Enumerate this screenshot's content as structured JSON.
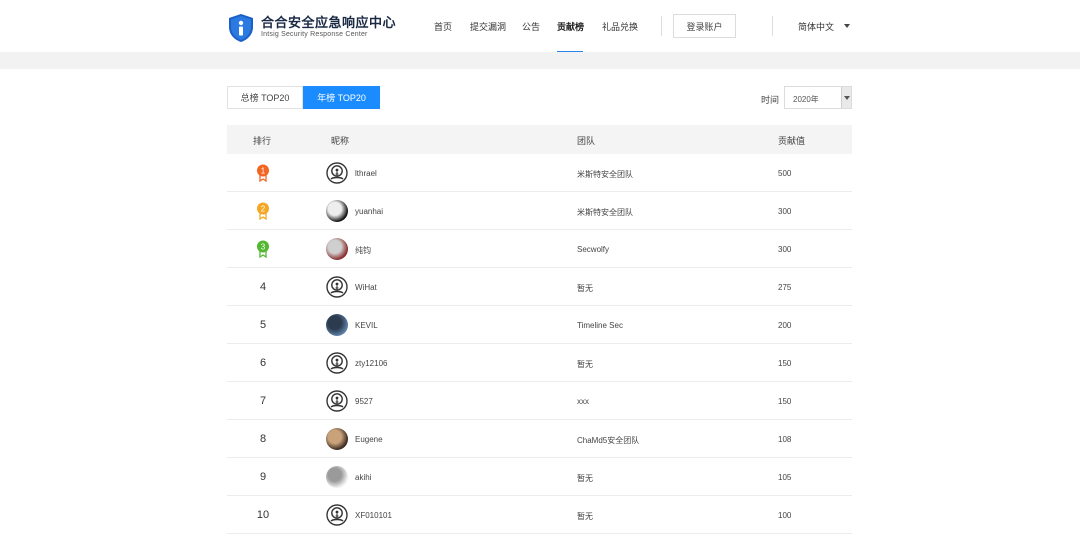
{
  "brand": {
    "title": "合合安全应急响应中心",
    "subtitle": "Intsig Security Response Center"
  },
  "nav": {
    "items": [
      {
        "label": "首页"
      },
      {
        "label": "提交漏洞"
      },
      {
        "label": "公告"
      },
      {
        "label": "贡献榜",
        "active": true
      },
      {
        "label": "礼品兑换"
      }
    ],
    "login": "登录账户",
    "language": "简体中文"
  },
  "tabs": [
    {
      "label": "总榜 TOP20",
      "active": false
    },
    {
      "label": "年榜 TOP20",
      "active": true
    }
  ],
  "filter": {
    "label": "时间",
    "value": "2020年"
  },
  "table": {
    "headers": {
      "rank": "排行",
      "nickname": "昵称",
      "team": "团队",
      "score": "贡献值"
    },
    "rows": [
      {
        "rank": "1",
        "medal": "medal-gold-icon",
        "avatar": "default-avatar-icon",
        "nickname": "lthrael",
        "team": "米斯特安全团队",
        "score": "500"
      },
      {
        "rank": "2",
        "medal": "medal-orange-icon",
        "avatar": "user-photo-avatar",
        "nickname": "yuanhai",
        "team": "米斯特安全团队",
        "score": "300"
      },
      {
        "rank": "3",
        "medal": "medal-green-icon",
        "avatar": "user-photo-avatar",
        "nickname": "纯钧",
        "team": "Secwolfy",
        "score": "300"
      },
      {
        "rank": "4",
        "avatar": "default-avatar-icon",
        "nickname": "WiHat",
        "team": "暂无",
        "score": "275"
      },
      {
        "rank": "5",
        "avatar": "user-photo-avatar",
        "nickname": "KEVIL",
        "team": "Timeline Sec",
        "score": "200"
      },
      {
        "rank": "6",
        "avatar": "default-avatar-icon",
        "nickname": "zty12106",
        "team": "暂无",
        "score": "150"
      },
      {
        "rank": "7",
        "avatar": "default-avatar-icon",
        "nickname": "9527",
        "team": "xxx",
        "score": "150"
      },
      {
        "rank": "8",
        "avatar": "user-photo-avatar",
        "nickname": "Eugene",
        "team": "ChaMd5安全团队",
        "score": "108"
      },
      {
        "rank": "9",
        "avatar": "user-photo-avatar",
        "nickname": "akihi",
        "team": "暂无",
        "score": "105"
      },
      {
        "rank": "10",
        "avatar": "default-avatar-icon",
        "nickname": "XF010101",
        "team": "暂无",
        "score": "100"
      }
    ]
  },
  "colors": {
    "accent": "#1a8cff",
    "nav_underline": "#2a86e8",
    "medal_gold": "#f26522",
    "medal_orange": "#f5a623",
    "medal_green": "#52b82f",
    "brand_blue": "#1b5fc7"
  }
}
